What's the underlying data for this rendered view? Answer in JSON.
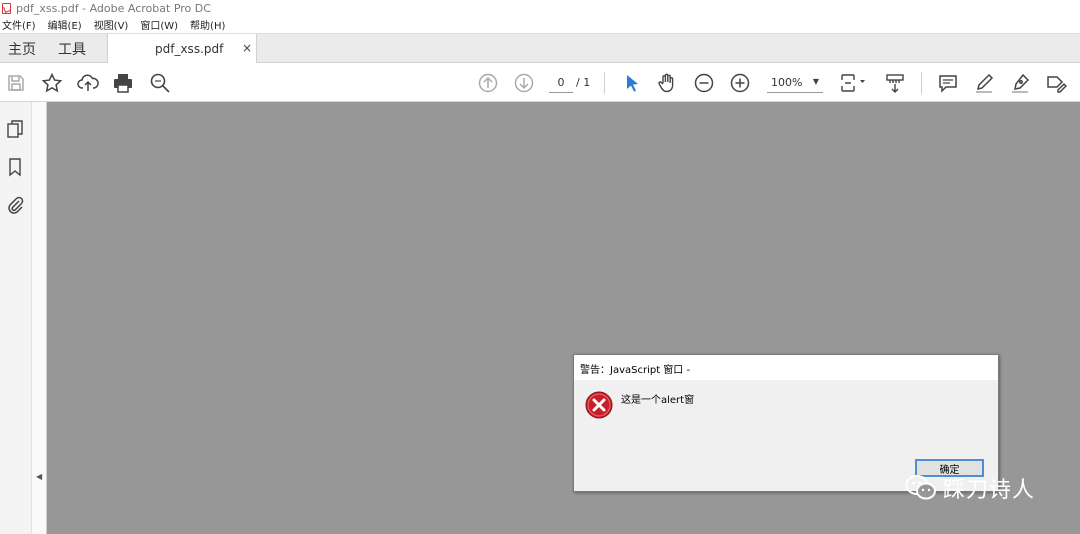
{
  "window": {
    "title": "pdf_xss.pdf - Adobe Acrobat Pro DC"
  },
  "menu": {
    "items": [
      {
        "label": "文件(F)"
      },
      {
        "label": "编辑(E)"
      },
      {
        "label": "视图(V)"
      },
      {
        "label": "窗口(W)"
      },
      {
        "label": "帮助(H)"
      }
    ]
  },
  "tabs": {
    "home": "主页",
    "tools": "工具",
    "document": "pdf_xss.pdf",
    "close_glyph": "×"
  },
  "toolbar": {
    "page_current": "0",
    "page_total": "/ 1",
    "zoom": "100%",
    "zoom_arrow": "▼",
    "accent_color": "#2d7bd8"
  },
  "sidepanel": {
    "collapse_glyph": "◀"
  },
  "dialog": {
    "title": "警告：JavaScript 窗口 -",
    "message": "这是一个alert窗",
    "ok_label": "确定",
    "icon": "error-icon",
    "icon_color": "#c8202a"
  },
  "watermark": {
    "text": "踩刀诗人",
    "icon": "wechat-icon"
  }
}
